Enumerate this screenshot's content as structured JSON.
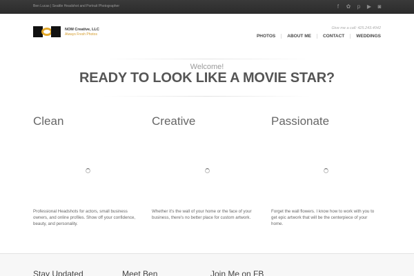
{
  "topbar": {
    "tagline": "Ben Lucas | Seattle Headshot and Portrait Photographer",
    "social": [
      {
        "icon": "facebook-icon",
        "glyph": "f"
      },
      {
        "icon": "flickr-icon",
        "glyph": "✿"
      },
      {
        "icon": "pinterest-icon",
        "glyph": "p"
      },
      {
        "icon": "youtube-icon",
        "glyph": "▶"
      },
      {
        "icon": "instagram-icon",
        "glyph": "◙"
      }
    ]
  },
  "header": {
    "brand_name": "NOM Creative, LLC",
    "brand_tagline": "Always Fresh Photos",
    "call": "Give me a call: 425.243.4042",
    "nav": [
      "PHOTOS",
      "ABOUT ME",
      "CONTACT",
      "WEDDINGS"
    ]
  },
  "intro": {
    "welcome": "Welcome!",
    "headline": "READY TO LOOK LIKE A MOVIE STAR?"
  },
  "columns": [
    {
      "title": "Clean",
      "text": "Professional Headshots for actors, small business owners, and online profiles. Show off your confidence, beauty, and personality."
    },
    {
      "title": "Creative",
      "text": "Whether it's the wall of your home or the face of your business, there's no better place for custom artwork."
    },
    {
      "title": "Passionate",
      "text": "Forget the wall flowers. I know how to work with you to get epic artwork that will be the centerpiece of your home."
    }
  ],
  "footer": {
    "headings": [
      "Stay Updated",
      "Meet Ben",
      "Join Me on FB"
    ]
  },
  "colors": {
    "topbar": "#2f2f2f",
    "accent": "#e3a92b",
    "text": "#555555"
  }
}
